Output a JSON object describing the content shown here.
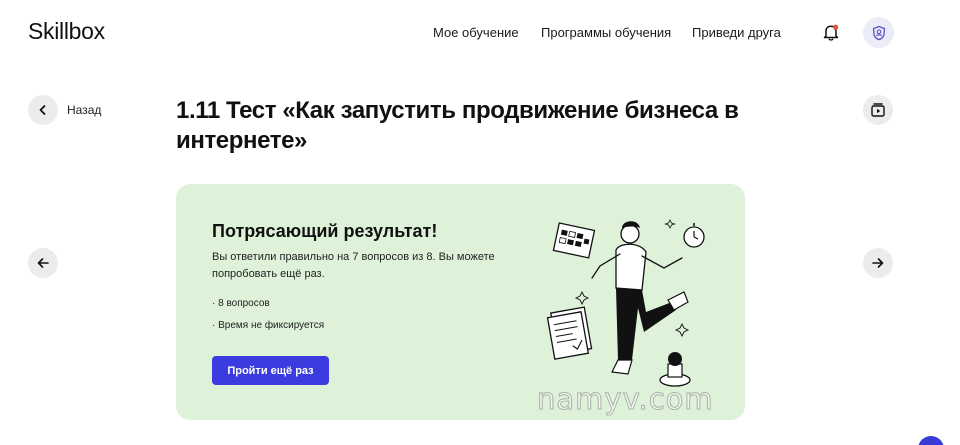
{
  "header": {
    "logo": "Skillbox",
    "nav": [
      "Мое обучение",
      "Программы обучения",
      "Приведи друга"
    ],
    "bell_icon": "bell-icon",
    "avatar_icon": "avatar-icon"
  },
  "lesson": {
    "back_label": "Назад",
    "title": "1.11 Тест «Как запустить продвижение бизнеса в интернете»"
  },
  "result": {
    "heading": "Потрясающий результат!",
    "description": "Вы ответили правильно на 7 вопросов из 8. Вы можете попробовать ещё раз.",
    "bullets": [
      "· 8 вопросов",
      "· Время не фиксируется"
    ],
    "retry_label": "Пройти ещё раз"
  },
  "watermark": "namyv.com",
  "colors": {
    "card_bg": "#def2da",
    "accent": "#3b3be0",
    "notification_dot": "#e8503a"
  }
}
